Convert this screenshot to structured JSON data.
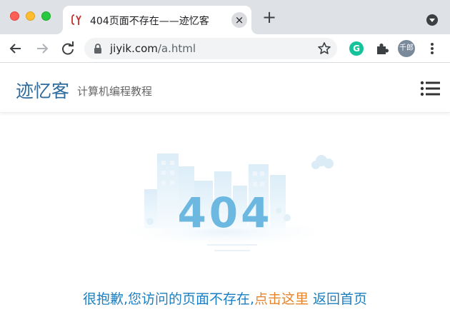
{
  "browser": {
    "tab": {
      "title": "404页面不存在——迹忆客",
      "close_label": "×"
    },
    "new_tab_label": "+",
    "address": {
      "host": "jiyik.com",
      "path": "/a.html"
    },
    "extensions": {
      "grammarly_label": "G"
    },
    "profile_label": "千郎",
    "icons": [
      "back-arrow-icon",
      "forward-arrow-icon",
      "reload-icon",
      "lock-icon",
      "star-icon",
      "puzzle-icon",
      "kebab-menu-icon",
      "tab-search-icon"
    ]
  },
  "site": {
    "brand": "迹忆客",
    "tagline": "计算机编程教程"
  },
  "error": {
    "code": "404",
    "message_prefix": "很抱歉,您访问的页面不存在,",
    "click_here": "点击这里",
    "return_home": "返回首页"
  },
  "colors": {
    "brand_blue": "#2e6c9d",
    "message_blue": "#1b7fc1",
    "link_orange": "#e6852b",
    "code_blue": "#6cb8e0"
  }
}
